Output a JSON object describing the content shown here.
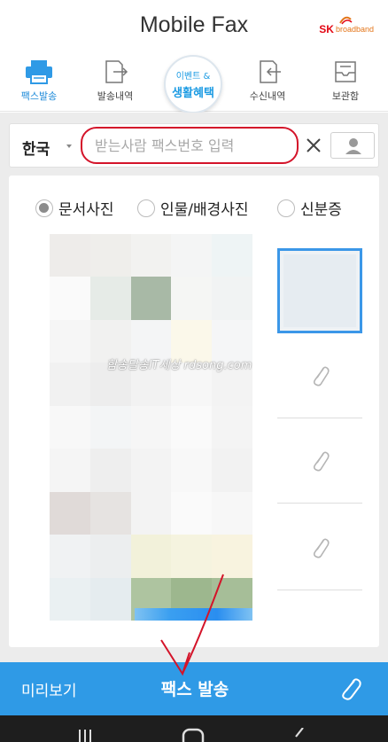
{
  "header": {
    "title": "Mobile Fax",
    "brand_sk": "SK",
    "brand_name": "broadband"
  },
  "nav": {
    "items": [
      {
        "label": "팩스발송",
        "icon": "printer-icon",
        "active": true
      },
      {
        "label": "발송내역",
        "icon": "send-history-icon",
        "active": false
      },
      {
        "label": "수신내역",
        "icon": "receive-history-icon",
        "active": false
      },
      {
        "label": "보관함",
        "icon": "archive-icon",
        "active": false
      }
    ],
    "event": {
      "line1": "이벤트 &",
      "line2": "생활혜택"
    }
  },
  "recipient": {
    "country": "한국",
    "placeholder": "받는사람 팩스번호 입력"
  },
  "photo_type": {
    "options": [
      "문서사진",
      "인물/배경사진",
      "신분증"
    ],
    "selected": "문서사진"
  },
  "watermark": "함송달송IT세상 rdsong.com",
  "bottom": {
    "preview_label": "미리보기",
    "send_label": "팩스 발송"
  },
  "colors": {
    "accent": "#2f9ae6",
    "nav_active": "#1c8ad9",
    "highlight_red": "#d4142a"
  }
}
